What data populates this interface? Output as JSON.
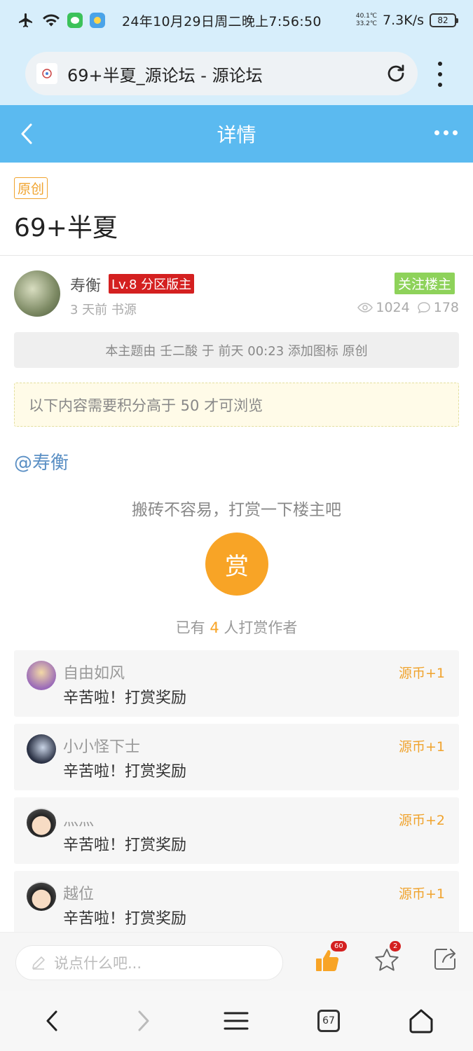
{
  "status_bar": {
    "clock": "24年10月29日周二晚上7:56:50",
    "temp_top": "40.1℃",
    "temp_bottom": "33.2℃",
    "net_speed": "7.3K/s",
    "battery": "82"
  },
  "browser": {
    "page_title": "69+半夏_源论坛 - 源论坛",
    "tab_count": "67"
  },
  "header": {
    "title": "详情"
  },
  "post": {
    "tag": "原创",
    "title": "69+半夏",
    "author": "寿衡",
    "level": "Lv.8 分区版主",
    "meta": "3 天前 书源",
    "follow_label": "关注楼主",
    "views": "1024",
    "comments": "178",
    "notice": "本主题由 壬二酸 于 前天 00:23 添加图标 原创",
    "locked_text": "以下内容需要积分高于 50 才可浏览",
    "mention": "@寿衡"
  },
  "reward": {
    "prompt": "搬砖不容易，打赏一下楼主吧",
    "button": "赏",
    "count_prefix": "已有",
    "count": "4",
    "count_suffix": "人打赏作者",
    "items": [
      {
        "name": "自由如风",
        "msg": "辛苦啦！打赏奖励",
        "coin": "源币+1"
      },
      {
        "name": "小小怪下士",
        "msg": "辛苦啦！打赏奖励",
        "coin": "源币+1"
      },
      {
        "name": "灬灬",
        "msg": "辛苦啦！打赏奖励",
        "coin": "源币+2"
      },
      {
        "name": "越位",
        "msg": "辛苦啦！打赏奖励",
        "coin": "源币+1"
      }
    ]
  },
  "actions": {
    "comment_placeholder": "说点什么吧...",
    "like_count": "60",
    "star_count": "2"
  },
  "colors": {
    "header_blue": "#5bbaf0",
    "accent_orange": "#f8a426",
    "level_red": "#d42020",
    "follow_green": "#8ed25a"
  }
}
